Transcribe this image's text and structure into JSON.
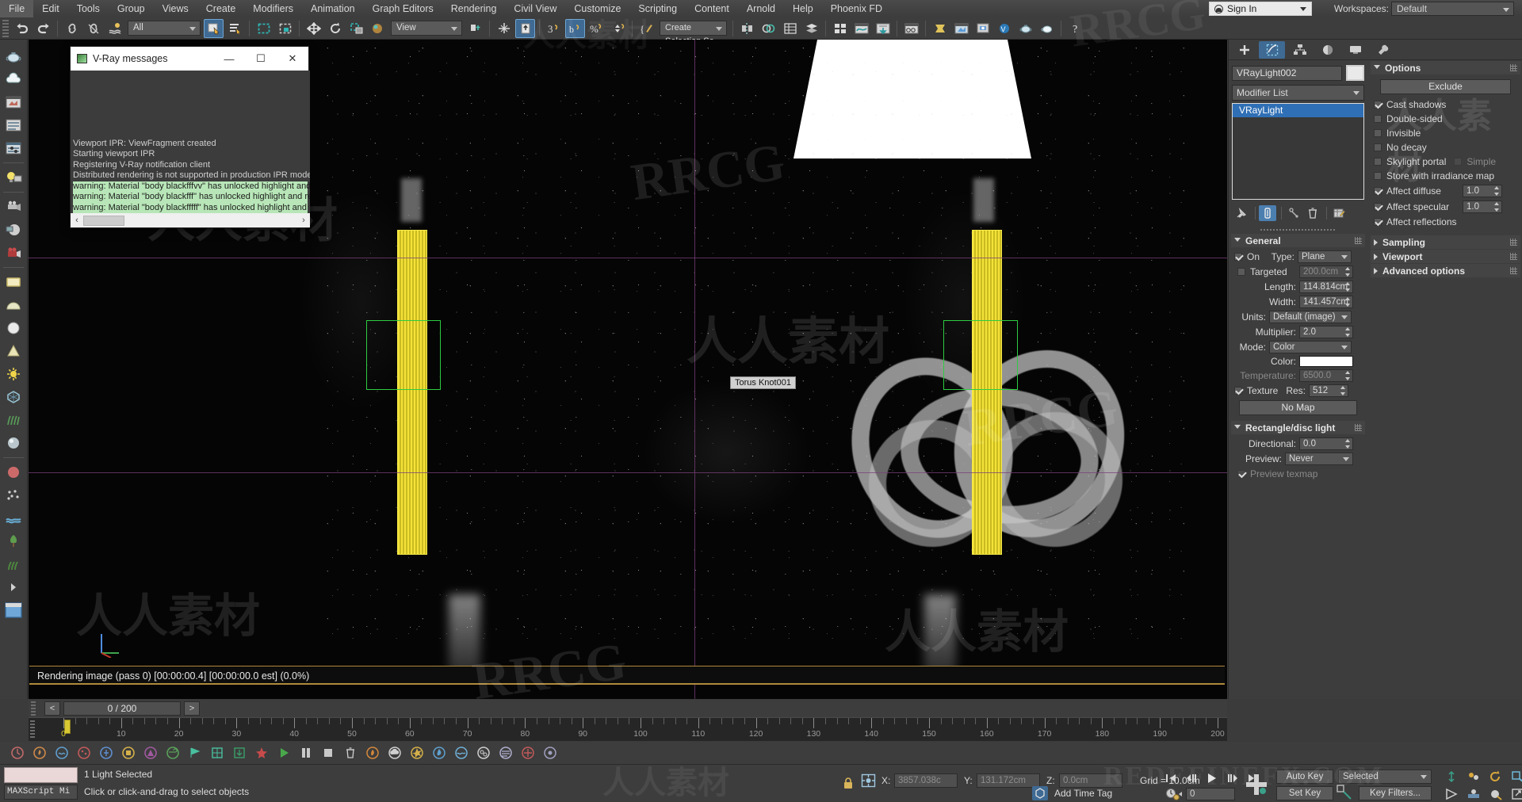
{
  "app": {
    "title": "Autodesk 3ds Max",
    "accent": "#3f6a93",
    "panel_bg": "#3d3d3d"
  },
  "menubar": {
    "items": [
      "File",
      "Edit",
      "Tools",
      "Group",
      "Views",
      "Create",
      "Modifiers",
      "Animation",
      "Graph Editors",
      "Rendering",
      "Civil View",
      "Customize",
      "Scripting",
      "Content",
      "Arnold",
      "Help",
      "Phoenix FD"
    ],
    "sign_in": "Sign In",
    "workspaces_label": "Workspaces:",
    "workspace_value": "Default"
  },
  "toolbar": {
    "selection_filter": "All",
    "reference_coord": "View",
    "named_selection_sets": "Create Selection Se"
  },
  "vray_window": {
    "title": "V-Ray messages",
    "minimize": "—",
    "maximize": "☐",
    "close": "✕",
    "lines": [
      {
        "text": "Viewport IPR: ViewFragment created",
        "warn": false
      },
      {
        "text": "Starting viewport IPR",
        "warn": false
      },
      {
        "text": "Registering V-Ray notification client",
        "warn": false
      },
      {
        "text": "Distributed rendering is not supported in production IPR mode.",
        "warn": false
      },
      {
        "text": "warning: Material \"body blackfffvv\" has unlocked highlight and re",
        "warn": true
      },
      {
        "text": "warning: Material \"body blackfff\" has unlocked highlight and ref",
        "warn": true
      },
      {
        "text": "warning: Material \"body blackfffff\" has unlocked highlight and re",
        "warn": true
      }
    ],
    "scroll_left": "‹",
    "scroll_right": "›"
  },
  "viewport": {
    "object_label": "Torus Knot001",
    "render_status": "Rendering image (pass 0) [00:00:00.4] [00:00:00.0 est]    (0.0%)"
  },
  "command_panel": {
    "tabs": [
      {
        "name": "create",
        "icon": "plus-icon",
        "selected": false
      },
      {
        "name": "modify",
        "icon": "modify-icon",
        "selected": true
      },
      {
        "name": "hierarchy",
        "icon": "hierarchy-icon",
        "selected": false
      },
      {
        "name": "motion",
        "icon": "motion-icon",
        "selected": false
      },
      {
        "name": "display",
        "icon": "display-icon",
        "selected": false
      },
      {
        "name": "utilities",
        "icon": "wrench-icon",
        "selected": false
      }
    ],
    "object_name": "VRayLight002",
    "modifier_list_label": "Modifier List",
    "modifier_stack": [
      {
        "label": "VRayLight",
        "selected": true
      }
    ],
    "options_rollout": {
      "title": "Options",
      "exclude_button": "Exclude",
      "checkboxes": [
        {
          "label": "Cast shadows",
          "checked": true,
          "disabled": false
        },
        {
          "label": "Double-sided",
          "checked": false,
          "disabled": false
        },
        {
          "label": "Invisible",
          "checked": false,
          "disabled": false
        },
        {
          "label": "No decay",
          "checked": false,
          "disabled": false
        },
        {
          "label": "Skylight portal",
          "checked": false,
          "disabled": false
        },
        {
          "label": "Store with irradiance map",
          "checked": false,
          "disabled": false
        }
      ],
      "simple_label": "Simple",
      "simple_checked": false,
      "affect_diffuse": {
        "label": "Affect diffuse",
        "checked": true,
        "value": "1.0"
      },
      "affect_specular": {
        "label": "Affect specular",
        "checked": true,
        "value": "1.0"
      },
      "affect_reflections": {
        "label": "Affect reflections",
        "checked": true
      }
    },
    "collapsed_rollouts": [
      {
        "title": "Sampling"
      },
      {
        "title": "Viewport"
      },
      {
        "title": "Advanced options"
      }
    ],
    "general_rollout": {
      "title": "General",
      "on_label": "On",
      "on_checked": true,
      "type_label": "Type:",
      "type_value": "Plane",
      "targeted_label": "Targeted",
      "targeted_checked": false,
      "target_distance": "200.0cm",
      "length_label": "Length:",
      "length_value": "114.814cm",
      "width_label": "Width:",
      "width_value": "141.457cm",
      "units_label": "Units:",
      "units_value": "Default (image)",
      "multiplier_label": "Multiplier:",
      "multiplier_value": "2.0",
      "mode_label": "Mode:",
      "mode_value": "Color",
      "color_label": "Color:",
      "color_value": "#ffffff",
      "temperature_label": "Temperature:",
      "temperature_value": "6500.0",
      "texture_label": "Texture",
      "texture_checked": true,
      "res_label": "Res:",
      "res_value": "512",
      "no_map_button": "No Map"
    },
    "rect_disc_rollout": {
      "title": "Rectangle/disc light",
      "directional_label": "Directional:",
      "directional_value": "0.0",
      "preview_label": "Preview:",
      "preview_value": "Never",
      "preview_texmap_label": "Preview texmap",
      "preview_texmap_checked": true
    }
  },
  "timeline": {
    "current_frame_display": "0 / 200",
    "prev_arrow": "<",
    "next_arrow": ">",
    "tick_labels": [
      "0",
      "10",
      "20",
      "30",
      "40",
      "50",
      "60",
      "70",
      "80",
      "90",
      "100",
      "110",
      "120",
      "130",
      "140",
      "150",
      "160",
      "170",
      "180",
      "190",
      "200"
    ]
  },
  "statusbar": {
    "maxscript_label": "MAXScript Mi",
    "selection_status": "1 Light Selected",
    "prompt": "Click or click-and-drag to select objects",
    "x_label": "X:",
    "x_value": "3857.038c",
    "y_label": "Y:",
    "y_value": "131.172cm",
    "z_label": "Z:",
    "z_value": "0.0cm",
    "grid_text": "Grid = 10.0cm",
    "add_time_tag": "Add Time Tag",
    "frame_value": "0",
    "auto_key": "Auto Key",
    "set_key": "Set Key",
    "key_mode_value": "Selected",
    "key_filters": "Key Filters..."
  },
  "watermarks": {
    "latin": "RRCG",
    "chinese": "人人素材",
    "bottom_right": "REDEFINEFX.COM"
  }
}
